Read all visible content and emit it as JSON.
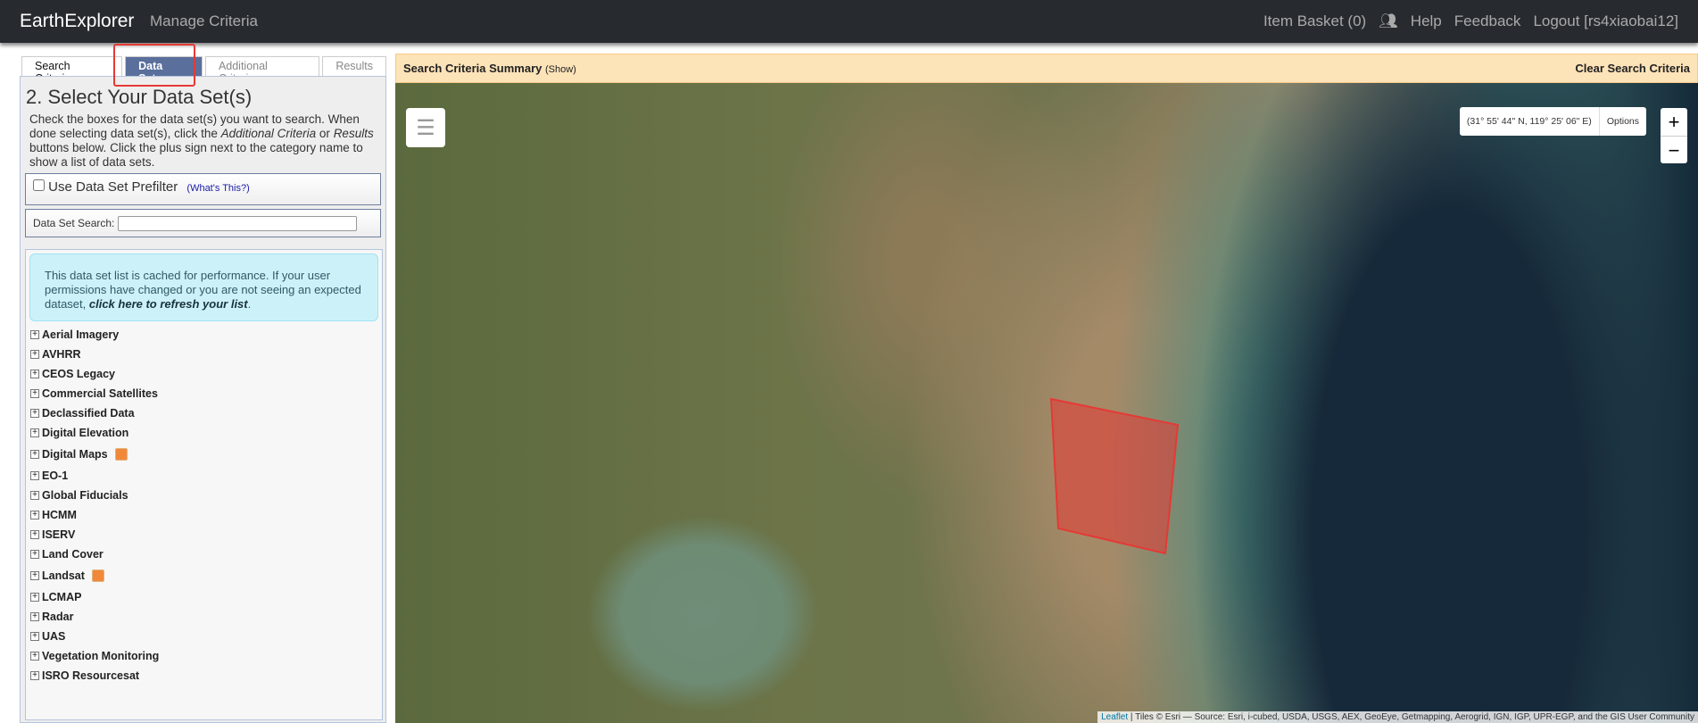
{
  "header": {
    "brand": "EarthExplorer",
    "manage": "Manage Criteria",
    "basket": "Item Basket (0)",
    "help": "Help",
    "feedback": "Feedback",
    "logout": "Logout [rs4xiaobai12]"
  },
  "tabs": [
    "Search Criteria",
    "Data Sets",
    "Additional Criteria",
    "Results"
  ],
  "panel": {
    "title": "2. Select Your Data Set(s)",
    "intro_1": "Check the boxes for the data set(s) you want to search. When done selecting data set(s), click the ",
    "intro_em1": "Additional Criteria",
    "intro_2": " or ",
    "intro_em2": "Results",
    "intro_3": " buttons below. Click the plus sign next to the category name to show a list of data sets.",
    "prefilter": "Use Data Set Prefilter",
    "whats_this": "(What's This?)",
    "search_label": "Data Set Search:",
    "search_value": "",
    "info_text": "This data set list is cached for performance. If your user permissions have changed or you are not seeing an expected dataset, ",
    "info_link": "click here to refresh your list",
    "info_end": ".",
    "categories": [
      "Aerial Imagery",
      "AVHRR",
      "CEOS Legacy",
      "Commercial Satellites",
      "Declassified Data",
      "Digital Elevation",
      "Digital Maps",
      "EO-1",
      "Global Fiducials",
      "HCMM",
      "ISERV",
      "Land Cover",
      "Landsat",
      "LCMAP",
      "Radar",
      "UAS",
      "Vegetation Monitoring",
      "ISRO Resourcesat"
    ],
    "badged": [
      "Digital Maps",
      "Landsat"
    ]
  },
  "map": {
    "summary": "Search Criteria Summary",
    "show": "(Show)",
    "clear": "Clear Search Criteria",
    "coords": "(31° 55' 44\" N, 119° 25' 06\" E)",
    "options": "Options",
    "zoom_in": "+",
    "zoom_out": "−",
    "attr_link": "Leaflet",
    "attr": " | Tiles © Esri — Source: Esri, i-cubed, USDA, USGS, AEX, GeoEye, Getmapping, Aerogrid, IGN, IGP, UPR-EGP, and the GIS User Community",
    "polygon_color": "#e53935"
  }
}
